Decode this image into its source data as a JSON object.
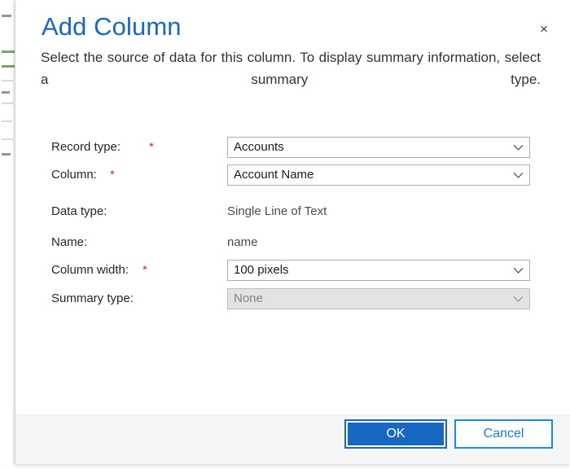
{
  "dialog": {
    "title": "Add Column",
    "description": "Select the source of data for this column. To display summary information, select a summary type.",
    "close_label": "×"
  },
  "form": {
    "fields": [
      {
        "label": "Record type:",
        "required": "*",
        "value": "Accounts",
        "kind": "dropdown",
        "disabled": false
      },
      {
        "label": "Column:",
        "required": "*",
        "value": "Account Name",
        "kind": "dropdown",
        "disabled": false
      },
      {
        "label": "Data type:",
        "required": "",
        "value": "Single Line of Text",
        "kind": "static",
        "disabled": false
      },
      {
        "label": "Name:",
        "required": "",
        "value": "name",
        "kind": "static",
        "disabled": false
      },
      {
        "label": "Column width:",
        "required": "*",
        "value": "100 pixels",
        "kind": "dropdown",
        "disabled": false
      },
      {
        "label": "Summary type:",
        "required": "",
        "value": "None",
        "kind": "dropdown",
        "disabled": true
      }
    ]
  },
  "footer": {
    "ok_label": "OK",
    "cancel_label": "Cancel"
  },
  "colors": {
    "title_blue": "#1867c0",
    "primary_button": "#1668c2",
    "cancel_border": "#1b8ae4",
    "required_red": "#c2352a",
    "disabled_field": "#e3e3e3",
    "footer_bg": "#f6f6f6"
  }
}
